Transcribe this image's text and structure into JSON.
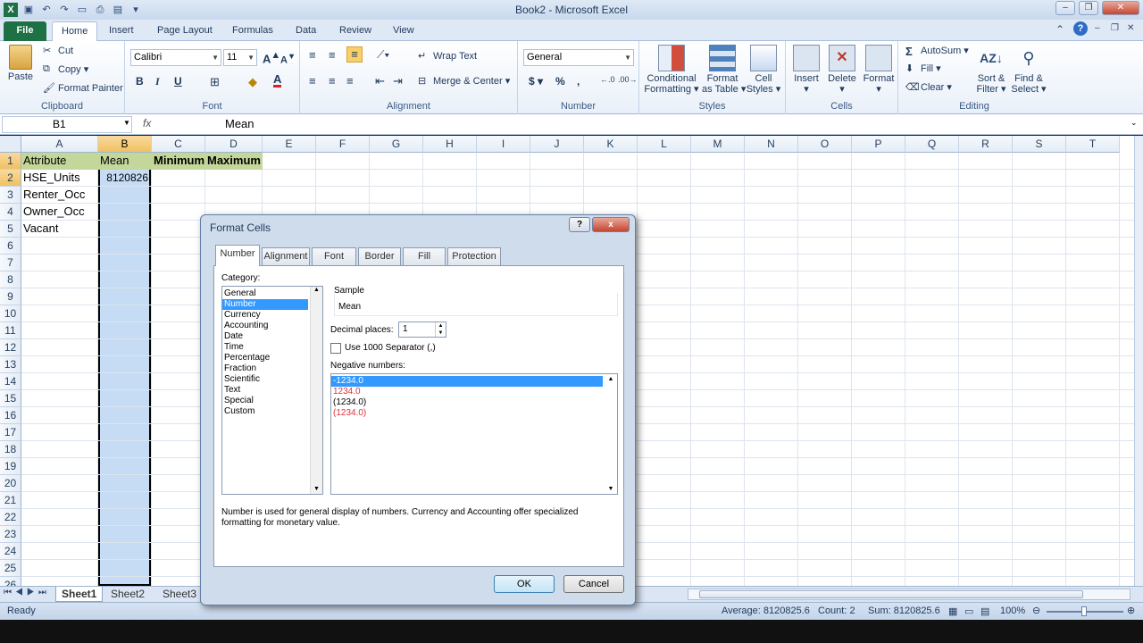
{
  "window": {
    "title": "Book2 - Microsoft Excel"
  },
  "tabs": [
    "File",
    "Home",
    "Insert",
    "Page Layout",
    "Formulas",
    "Data",
    "Review",
    "View"
  ],
  "ribbon": {
    "clipboard": {
      "paste": "Paste",
      "cut": "Cut",
      "copy": "Copy",
      "format_painter": "Format Painter",
      "label": "Clipboard"
    },
    "font": {
      "name": "Calibri",
      "size": "11",
      "label": "Font",
      "bold": "B",
      "italic": "I",
      "underline": "U"
    },
    "alignment": {
      "wrap": "Wrap Text",
      "merge": "Merge & Center",
      "label": "Alignment"
    },
    "number": {
      "format": "General",
      "currency": "$",
      "percent": "%",
      "comma": ",",
      "label": "Number"
    },
    "styles": {
      "conditional": "Conditional",
      "conditional2": "Formatting",
      "format_table": "Format",
      "format_table2": "as Table",
      "cell_styles": "Cell",
      "cell_styles2": "Styles",
      "label": "Styles"
    },
    "cells": {
      "insert": "Insert",
      "delete": "Delete",
      "format": "Format",
      "label": "Cells"
    },
    "editing": {
      "autosum": "AutoSum",
      "fill": "Fill",
      "clear": "Clear",
      "sort": "Sort &",
      "sort2": "Filter",
      "find": "Find &",
      "find2": "Select",
      "label": "Editing"
    }
  },
  "formula_bar": {
    "name_box": "B1",
    "fx": "fx",
    "value": "Mean"
  },
  "columns": [
    "A",
    "B",
    "C",
    "D",
    "E",
    "F",
    "G",
    "H",
    "I",
    "J",
    "K",
    "L",
    "M",
    "N",
    "O",
    "P",
    "Q",
    "R",
    "S",
    "T"
  ],
  "rows": [
    "1",
    "2",
    "3",
    "4",
    "5",
    "6",
    "7",
    "8",
    "9",
    "10",
    "11",
    "12",
    "13",
    "14",
    "15",
    "16",
    "17",
    "18",
    "19",
    "20",
    "21",
    "22",
    "23",
    "24",
    "25",
    "26"
  ],
  "cells": {
    "A1": "Attribute",
    "B1": "Mean",
    "C1": "Minimum",
    "D1": "Maximum",
    "A2": "HSE_Units",
    "B2": "8120826",
    "A3": "Renter_Occ",
    "A4": "Owner_Occ",
    "A5": "Vacant"
  },
  "sheets": [
    "Sheet1",
    "Sheet2",
    "Sheet3"
  ],
  "status": {
    "ready": "Ready",
    "average": "Average: 8120825.6",
    "count": "Count: 2",
    "sum": "Sum: 8120825.6",
    "zoom": "100%"
  },
  "dialog": {
    "title": "Format Cells",
    "help": "?",
    "close": "x",
    "tabs": [
      "Number",
      "Alignment",
      "Font",
      "Border",
      "Fill",
      "Protection"
    ],
    "category_label": "Category:",
    "categories": [
      "General",
      "Number",
      "Currency",
      "Accounting",
      "Date",
      "Time",
      "Percentage",
      "Fraction",
      "Scientific",
      "Text",
      "Special",
      "Custom"
    ],
    "selected_category": "Number",
    "sample_label": "Sample",
    "sample_value": "Mean",
    "decimal_label": "Decimal places:",
    "decimal_value": "1",
    "separator_label": "Use 1000 Separator (,)",
    "negative_label": "Negative numbers:",
    "negatives": [
      "-1234.0",
      "1234.0",
      "(1234.0)",
      "(1234.0)"
    ],
    "negative_colors": [
      "#ffffff",
      "#e0303a",
      "#000000",
      "#e0303a"
    ],
    "description": "Number is used for general display of numbers.  Currency and Accounting offer specialized formatting for monetary value.",
    "ok": "OK",
    "cancel": "Cancel"
  },
  "colors": {
    "excel_green": "#1e7145",
    "header_fill": "#c4d79b",
    "selection": "#c5dcf4",
    "list_select": "#3399ff"
  }
}
